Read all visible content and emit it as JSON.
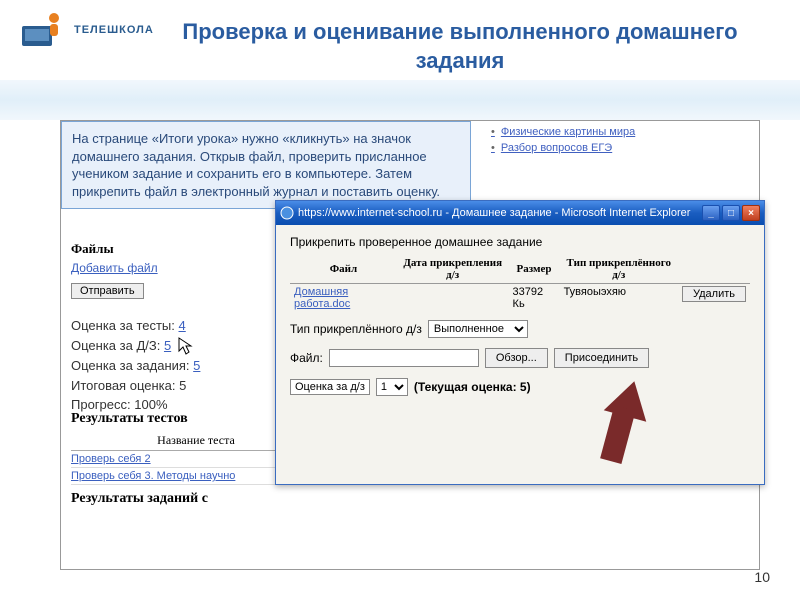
{
  "logo": {
    "text": "ТЕЛЕШКОЛА"
  },
  "slide": {
    "title": "Проверка и оценивание выполненного домашнего задания",
    "page_number": "10"
  },
  "instruction": "На странице «Итоги урока» нужно «кликнуть» на значок домашнего задания. Открыв файл, проверить присланное учеником задание и сохранить его в компьютере. Затем прикрепить файл в электронный журнал и поставить оценку.",
  "side_links": [
    "Физические картины мира",
    "Разбор вопросов ЕГЭ"
  ],
  "files": {
    "label": "Файлы",
    "add_link": "Добавить файл",
    "send_btn": "Отправить"
  },
  "grades": {
    "tests_label": "Оценка за тесты:",
    "tests_value": "4",
    "dz_label": "Оценка за Д/З:",
    "dz_value": "5",
    "tasks_label": "Оценка за задания:",
    "tasks_value": "5",
    "total_label": "Итоговая оценка:",
    "total_value": "5",
    "progress_label": "Прогресс:",
    "progress_value": "100%"
  },
  "results_tests": {
    "header": "Результаты тестов",
    "col_header": "Название теста",
    "rows": [
      "Проверь себя 2",
      "Проверь себя 3. Методы научно"
    ]
  },
  "results_tasks": {
    "header": "Результаты заданий с"
  },
  "popup": {
    "title": "https://www.internet-school.ru - Домашнее задание - Microsoft Internet Explorer",
    "heading": "Прикрепить проверенное домашнее задание",
    "cols": {
      "file": "Файл",
      "date": "Дата прикрепления д/з",
      "size": "Размер",
      "type": "Тип прикреплённого д/з"
    },
    "row": {
      "file": "Домашняя работа.doc",
      "date": "",
      "size": "33792 Кь",
      "type": "Тувяоыэхяю"
    },
    "delete_btn": "Удалить",
    "type_label": "Тип прикреплённого д/з",
    "type_value": "Выполненное",
    "file_label": "Файл:",
    "browse_btn": "Обзор...",
    "attach_btn": "Присоединить",
    "grade_label": "Оценка за д/з",
    "grade_value": "1",
    "current_grade": "(Текущая оценка: 5)"
  }
}
